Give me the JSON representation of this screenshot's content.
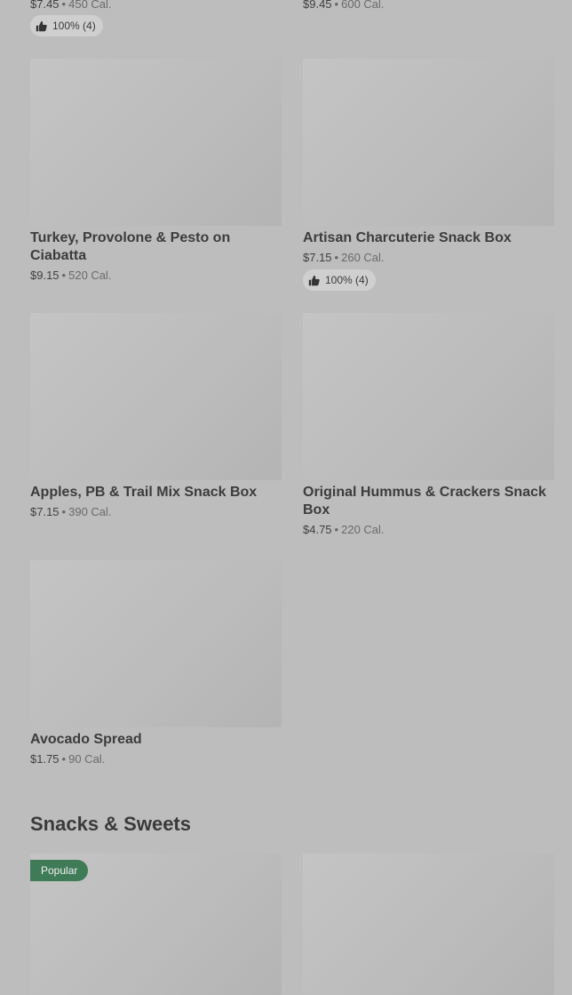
{
  "items": [
    {
      "name": "",
      "price": "$7.45",
      "calories": "450 Cal.",
      "rating": "100% (4)"
    },
    {
      "name": "",
      "price": "$9.45",
      "calories": "600 Cal."
    },
    {
      "name": "Turkey, Provolone & Pesto on Ciabatta",
      "name_line1": "Turkey, Provolone & Pesto on",
      "name_line2": "Ciabatta",
      "price": "$9.15",
      "calories": "520 Cal."
    },
    {
      "name": "Artisan Charcuterie Snack Box",
      "price": "$7.15",
      "calories": "260 Cal.",
      "rating": "100% (4)"
    },
    {
      "name": "Apples, PB & Trail Mix Snack Box",
      "price": "$7.15",
      "calories": "390 Cal."
    },
    {
      "name": "Original Hummus & Crackers Snack Box",
      "name_line1": "Original Hummus & Crackers Snack",
      "name_line2": "Box",
      "price": "$4.75",
      "calories": "220 Cal."
    },
    {
      "name": "Avocado Spread",
      "price": "$1.75",
      "calories": "90 Cal."
    }
  ],
  "separator": "•",
  "section": {
    "title": "Snacks & Sweets",
    "badge": "Popular"
  },
  "icons": {
    "rating": "thumbs-up-icon"
  },
  "colors": {
    "badge": "#3f7b57",
    "background": "#bdbdbd"
  }
}
